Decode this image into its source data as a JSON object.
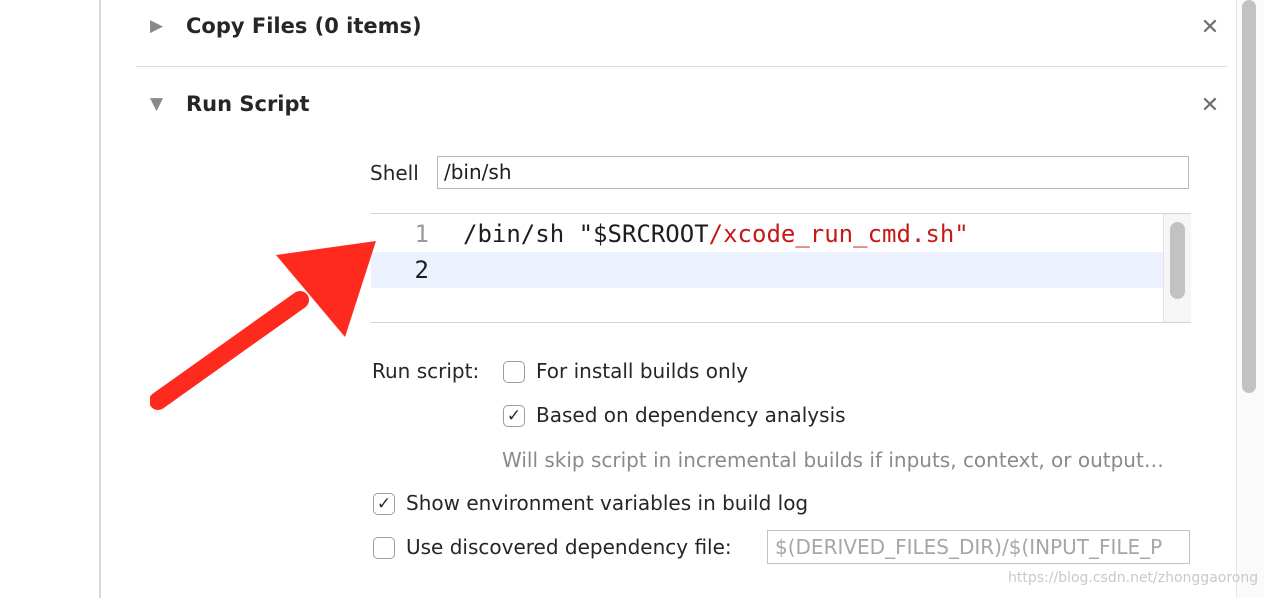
{
  "phases": {
    "copy_files": {
      "title": "Copy Files (0 items)",
      "toggle_icon": "▶",
      "delete_icon": "✕",
      "expanded": false
    },
    "run_script": {
      "title": "Run Script",
      "toggle_icon": "▼",
      "delete_icon": "✕",
      "expanded": true
    }
  },
  "shell": {
    "label": "Shell",
    "value": "/bin/sh"
  },
  "editor": {
    "lines": [
      {
        "number": "1",
        "tokens": [
          {
            "text": "/bin/sh \"$SRCROOT",
            "kind": "plain"
          },
          {
            "text": "/xcode_run_cmd.sh",
            "kind": "str"
          },
          {
            "text": "\"",
            "kind": "str"
          }
        ]
      },
      {
        "number": "2",
        "tokens": []
      }
    ],
    "current_line": 2
  },
  "run_script_options": {
    "label": "Run script:",
    "install_builds_only": {
      "label": "For install builds only",
      "checked": false
    },
    "dependency_analysis": {
      "label": "Based on dependency analysis",
      "checked": true
    },
    "hint": "Will skip script in incremental builds if inputs, context, or output…"
  },
  "show_env_vars": {
    "label": "Show environment variables in build log",
    "checked": true
  },
  "discovered_dependency": {
    "label": "Use discovered dependency file:",
    "checked": false,
    "placeholder": "$(DERIVED_FILES_DIR)/$(INPUT_FILE_P"
  },
  "check_glyph": "✓",
  "colors": {
    "string": "#c41a16",
    "current_line": "#ebf2fd",
    "arrow": "#ff2a1e"
  },
  "watermark": "https://blog.csdn.net/zhonggaorong"
}
